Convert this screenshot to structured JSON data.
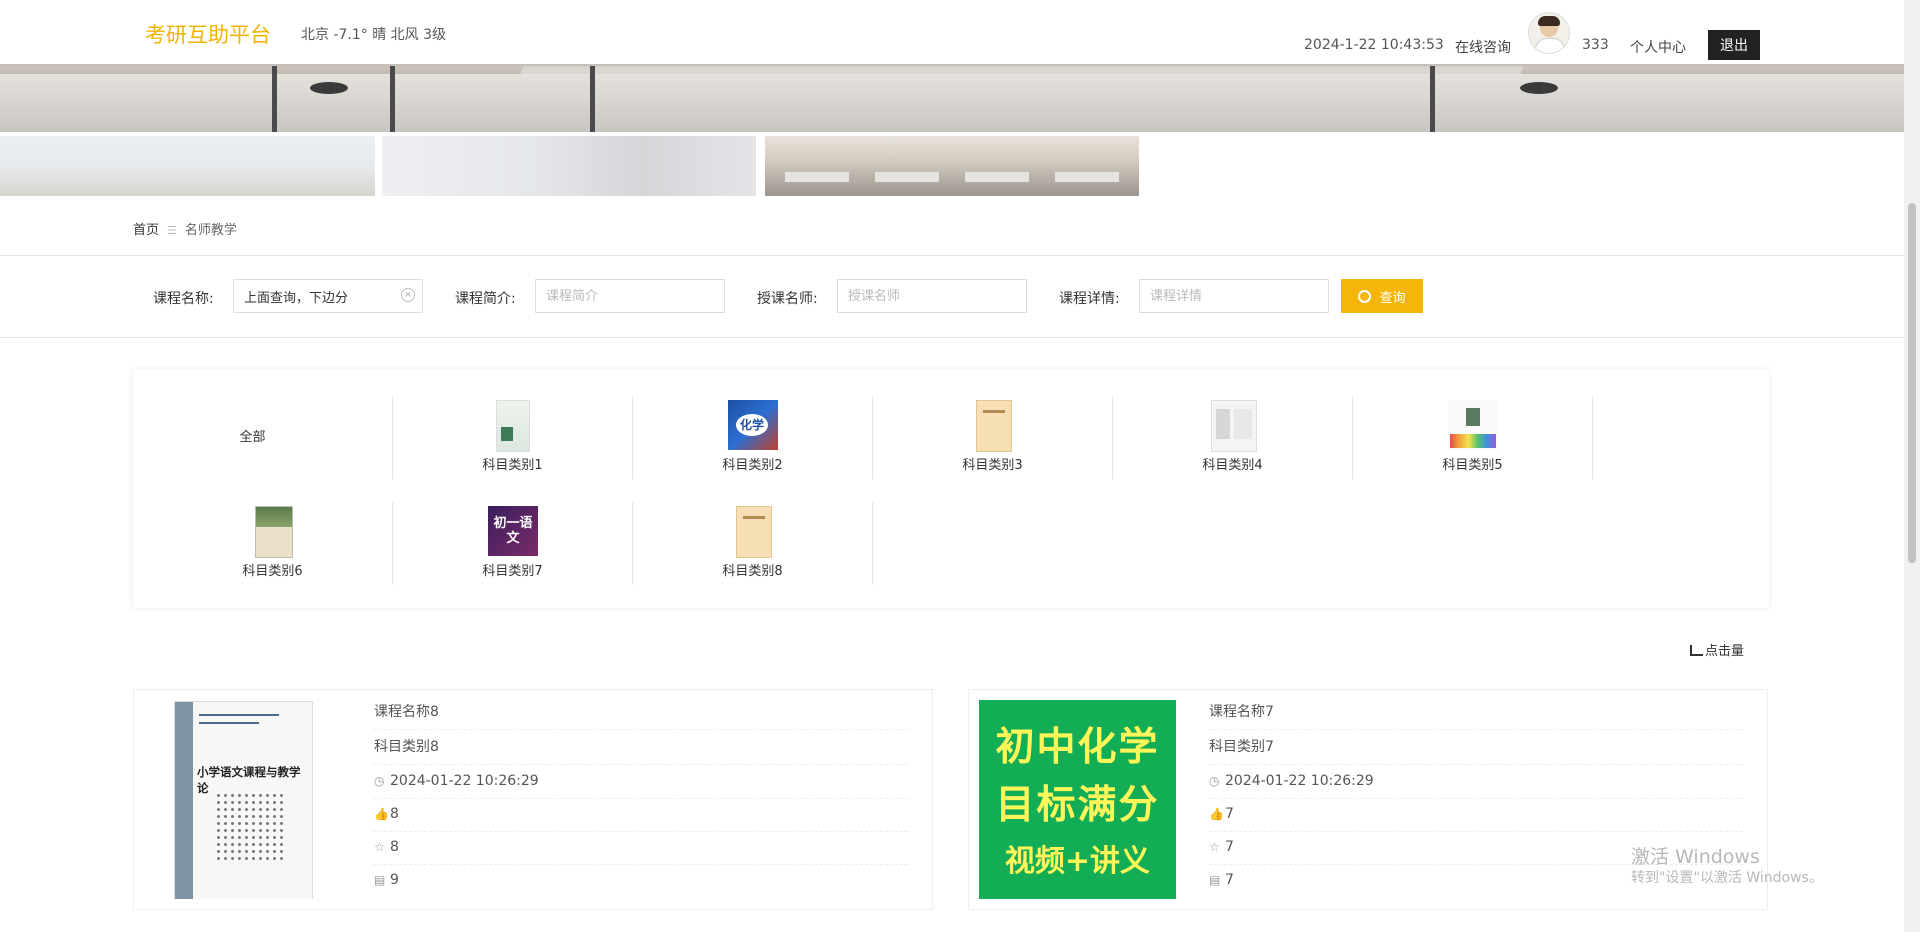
{
  "header": {
    "logo": "考研互助平台",
    "weather": "北京  -7.1°  晴  北风  3级",
    "datetime": "2024-1-22 10:43:53",
    "consult": "在线咨询",
    "username": "333",
    "personal_center": "个人中心",
    "logout": "退出"
  },
  "breadcrumb": {
    "home": "首页",
    "separator": "☰",
    "current": "名师教学"
  },
  "search": {
    "fields": [
      {
        "label": "课程名称:",
        "value": "上面查询，下边分",
        "placeholder": ""
      },
      {
        "label": "课程简介:",
        "value": "",
        "placeholder": "课程简介"
      },
      {
        "label": "授课名师:",
        "value": "",
        "placeholder": "授课名师"
      },
      {
        "label": "课程详情:",
        "value": "",
        "placeholder": "课程详情"
      }
    ],
    "button": "查询"
  },
  "categories": [
    {
      "label": "全部"
    },
    {
      "label": "科目类别1"
    },
    {
      "label": "科目类别2",
      "cover_text": "化学"
    },
    {
      "label": "科目类别3"
    },
    {
      "label": "科目类别4"
    },
    {
      "label": "科目类别5"
    },
    {
      "label": "科目类别6"
    },
    {
      "label": "科目类别7",
      "cover_text": "初一语文"
    },
    {
      "label": "科目类别8"
    }
  ],
  "sort": {
    "label": "点击量"
  },
  "courses": [
    {
      "name": "课程名称8",
      "category": "科目类别8",
      "time": "2024-01-22 10:26:29",
      "likes": "8",
      "favorites": "8",
      "comments": "9",
      "cover_title": "小学语文课程与教学论"
    },
    {
      "name": "课程名称7",
      "category": "科目类别7",
      "time": "2024-01-22 10:26:29",
      "likes": "7",
      "favorites": "7",
      "comments": "7",
      "cover_lines": [
        "初中化学",
        "目标满分",
        "视频+讲义"
      ]
    }
  ],
  "watermark": {
    "line1": "激活 Windows",
    "line2": "转到\"设置\"以激活 Windows。"
  },
  "colors": {
    "accent": "#f5b50a",
    "logo": "#f0b400",
    "logout_bg": "#222222",
    "poster_bg": "#13ad55",
    "poster_text": "#fff75a"
  }
}
